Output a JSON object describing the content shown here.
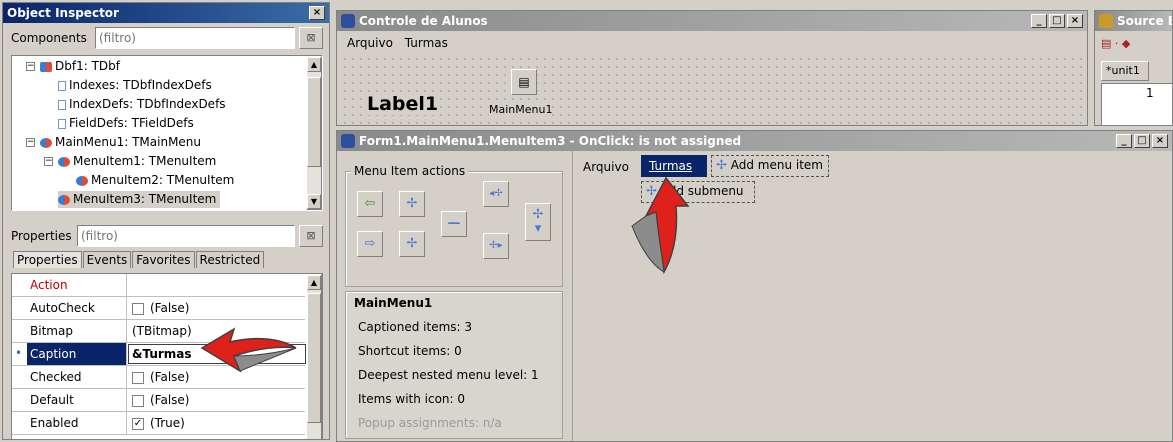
{
  "object_inspector": {
    "title": "Object Inspector",
    "close_glyph": "×",
    "components_label": "Components",
    "components_filter_placeholder": "(filtro)",
    "tree": [
      {
        "label": "Dbf1: TDbf",
        "level": 0,
        "toggle": "−",
        "icon": "db-icon"
      },
      {
        "label": "Indexes: TDbfIndexDefs",
        "level": 1,
        "icon": "collection-icon"
      },
      {
        "label": "IndexDefs: TDbfIndexDefs",
        "level": 1,
        "icon": "collection-icon"
      },
      {
        "label": "FieldDefs: TFieldDefs",
        "level": 1,
        "icon": "collection-icon"
      },
      {
        "label": "MainMenu1: TMainMenu",
        "level": 0,
        "toggle": "−",
        "icon": "menu-icon"
      },
      {
        "label": "MenuItem1: TMenuItem",
        "level": 1,
        "toggle": "−",
        "icon": "menu-icon"
      },
      {
        "label": "MenuItem2: TMenuItem",
        "level": 2,
        "icon": "menu-icon"
      },
      {
        "label": "MenuItem3: TMenuItem",
        "level": 1,
        "icon": "menu-icon",
        "selected": true
      }
    ],
    "properties_label": "Properties",
    "properties_filter_placeholder": "(filtro)",
    "tabs": [
      "Properties",
      "Events",
      "Favorites",
      "Restricted"
    ],
    "properties": [
      {
        "name": "Action",
        "value": "",
        "type": "text",
        "red": true
      },
      {
        "name": "AutoCheck",
        "value": "(False)",
        "type": "check",
        "checked": false
      },
      {
        "name": "Bitmap",
        "value": "(TBitmap)",
        "type": "text"
      },
      {
        "name": "Caption",
        "value": "&Turmas",
        "type": "edit",
        "selected": true
      },
      {
        "name": "Checked",
        "value": "(False)",
        "type": "check",
        "checked": false
      },
      {
        "name": "Default",
        "value": "(False)",
        "type": "check",
        "checked": false
      },
      {
        "name": "Enabled",
        "value": "(True)",
        "type": "check",
        "checked": true
      }
    ]
  },
  "form_window": {
    "title": "Controle de Alunos",
    "menu": [
      "Arquivo",
      "Turmas"
    ],
    "label": "Label1",
    "component_caption": "MainMenu1",
    "buttons": [
      "_",
      "□",
      "×"
    ]
  },
  "source_window": {
    "title": "Source E",
    "tab": "*unit1",
    "line_number": "1"
  },
  "menu_editor": {
    "title": "Form1.MainMenu1.MenuItem3 - OnClick: is not assigned",
    "buttons": [
      "_",
      "□",
      "×"
    ],
    "actions_group": "Menu Item actions",
    "info_group": "MainMenu1",
    "info_lines": [
      "Captioned items: 3",
      "Shortcut items: 0",
      "Deepest nested menu level: 1",
      "Items with icon: 0",
      "Popup assignments: n/a"
    ],
    "menu_bar": [
      "Arquivo",
      "Turmas"
    ],
    "add_menu_item": "Add menu item",
    "add_submenu": "Add submenu"
  },
  "colors": {
    "selection": "#0a246a",
    "arrow": "#e0201a",
    "property_red": "#c00000"
  }
}
